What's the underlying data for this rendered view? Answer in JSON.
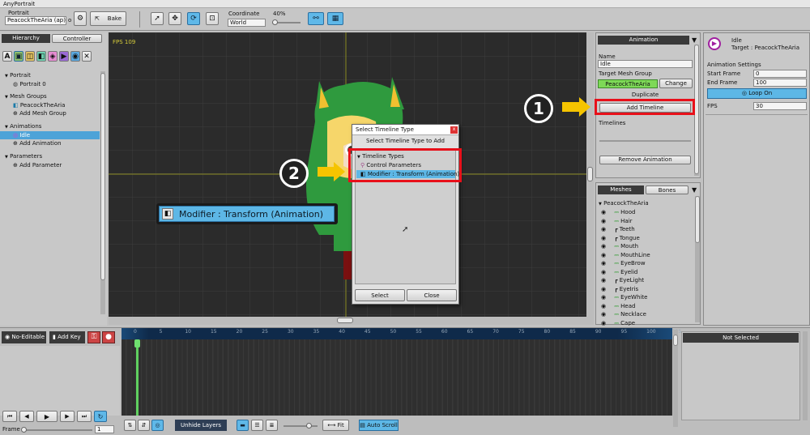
{
  "window": {
    "title": "AnyPortrait"
  },
  "toolbar": {
    "portrait_label": "Portrait",
    "portrait_value": "PeacockTheAria (ap)",
    "portrait_suffix": "o",
    "bake_label": "Bake",
    "coordinate_label": "Coordinate",
    "coordinate_value": "World",
    "zoom_label": "40%",
    "zoom_value": 0.4
  },
  "hierarchy": {
    "tab_hierarchy": "Hierarchy",
    "tab_controller": "Controller",
    "sections": {
      "portrait": "Portrait",
      "portrait0": "Portrait 0",
      "mesh_groups": "Mesh Groups",
      "peacock": "PeacockTheAria",
      "add_mesh_group": "Add Mesh Group",
      "animations": "Animations",
      "idle": "Idle",
      "add_animation": "Add Animation",
      "parameters": "Parameters",
      "add_parameter": "Add Parameter"
    }
  },
  "viewport": {
    "fps": "FPS 109"
  },
  "tooltip_big": {
    "label": "Modifier : Transform (Animation)"
  },
  "dialog": {
    "title": "Select Timeline Type",
    "heading": "Select Timeline Type to Add",
    "group": "Timeline Types",
    "item1": "Control Parameters",
    "item2": "Modifier : Transform (Animation)",
    "select_btn": "Select",
    "close_btn": "Close",
    "close_x": "x"
  },
  "callouts": {
    "one": "1",
    "two": "2"
  },
  "animation_panel": {
    "header": "Animation",
    "name_label": "Name",
    "name_value": "Idle",
    "target_label": "Target Mesh Group",
    "target_value": "PeacockTheAria",
    "change_btn": "Change",
    "duplicate_btn": "Duplicate",
    "add_timeline_btn": "Add Timeline",
    "timelines_label": "Timelines",
    "remove_btn": "Remove Animation"
  },
  "meshes_panel": {
    "tab_meshes": "Meshes",
    "tab_bones": "Bones",
    "root": "PeacockTheAria",
    "items": [
      "Hood",
      "Hair",
      "Teeth",
      "Tongue",
      "Mouth",
      "MouthLine",
      "EyeBrow",
      "Eyelid",
      "EyeLight",
      "EyeIris",
      "EyeWhite",
      "Head",
      "Necklace",
      "Cape"
    ]
  },
  "right_panel": {
    "title": "Idle",
    "target": "Target : PeacockTheAria",
    "settings": "Animation Settings",
    "start_label": "Start Frame",
    "start_value": "0",
    "end_label": "End Frame",
    "end_value": "100",
    "loop_btn": "Loop On",
    "fps_label": "FPS",
    "fps_value": "30"
  },
  "timeline": {
    "no_editable": "No-Editable",
    "add_key": "Add Key",
    "ruler": [
      "0",
      "5",
      "10",
      "15",
      "20",
      "25",
      "30",
      "35",
      "40",
      "45",
      "50",
      "55",
      "60",
      "65",
      "70",
      "75",
      "80",
      "85",
      "90",
      "95",
      "100",
      "105"
    ],
    "not_selected": "Not Selected",
    "frame_label": "Frame",
    "frame_value": "1",
    "unhide_layers": "Unhide Layers",
    "fit": "Fit",
    "auto_scroll": "Auto Scroll"
  },
  "colors": {
    "accent": "#5fb8e8",
    "highlight_red": "#e8101a",
    "callout_arrow": "#f5c400",
    "viewport": "#2b2b2b",
    "mesh_green": "#7ed957"
  }
}
